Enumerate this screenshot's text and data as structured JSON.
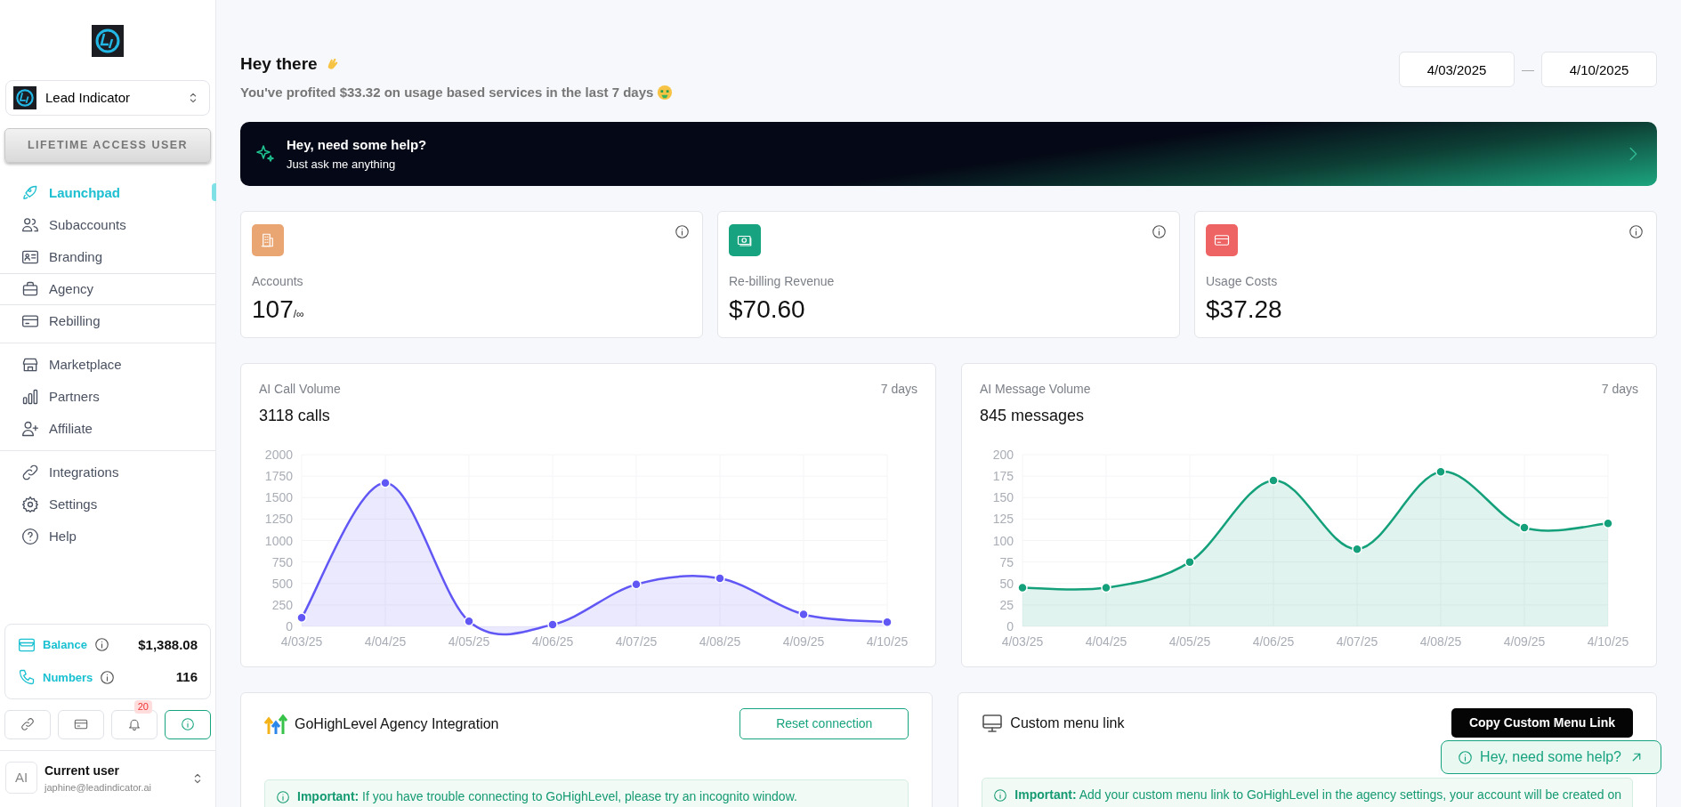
{
  "sidebar": {
    "workspace": "Lead Indicator",
    "access_badge": "LIFETIME ACCESS USER",
    "groups": [
      [
        {
          "label": "Launchpad",
          "selected": true,
          "hovered": false
        },
        {
          "label": "Subaccounts",
          "selected": false,
          "hovered": false
        },
        {
          "label": "Branding",
          "selected": false,
          "hovered": false
        },
        {
          "label": "Agency",
          "selected": false,
          "hovered": true
        },
        {
          "label": "Rebilling",
          "selected": false,
          "hovered": false
        }
      ],
      [
        {
          "label": "Marketplace",
          "selected": false,
          "hovered": false
        },
        {
          "label": "Partners",
          "selected": false,
          "hovered": false
        },
        {
          "label": "Affiliate",
          "selected": false,
          "hovered": false
        }
      ],
      [
        {
          "label": "Integrations",
          "selected": false,
          "hovered": false
        },
        {
          "label": "Settings",
          "selected": false,
          "hovered": false
        },
        {
          "label": "Help",
          "selected": false,
          "hovered": false
        }
      ]
    ],
    "balance": {
      "label": "Balance",
      "value": "$1,388.08"
    },
    "numbers": {
      "label": "Numbers",
      "value": "116"
    },
    "quick_buttons": [
      {
        "selected": false
      },
      {
        "selected": false
      },
      {
        "selected": false,
        "badge": "20"
      },
      {
        "selected": true
      }
    ],
    "user": {
      "avatar": "AI",
      "name": "Current user",
      "email": "japhine@leadindicator.ai"
    }
  },
  "header": {
    "greeting": "Hey there",
    "subtitle": "You've profited **$33.32** on usage based services in the last 7 days",
    "date_from": "4/03/2025",
    "date_separator": "—",
    "date_to": "4/10/2025"
  },
  "help_banner": {
    "title": "Hey, need some help?",
    "subtitle": "Just ask me anything"
  },
  "stats": [
    {
      "color": "#e9a673",
      "label": "Accounts",
      "value": "107",
      "suffix": "/∞"
    },
    {
      "color": "#17a37f",
      "label": "Re-billing Revenue",
      "value": "$70.60"
    },
    {
      "color": "#ee6363",
      "label": "Usage Costs",
      "value": "$37.28"
    }
  ],
  "charts": [
    {
      "title": "AI Call Volume",
      "period": "7 days",
      "total": "3118 calls",
      "chart_data": {
        "type": "area",
        "grid": true,
        "categories": [
          "4/03/25",
          "4/04/25",
          "4/05/25",
          "4/06/25",
          "4/07/25",
          "4/08/25",
          "4/09/25",
          "4/10/25"
        ],
        "series": [
          {
            "color": "#6157f5",
            "values": [
              100,
              1670,
              60,
              20,
              490,
              560,
              140,
              50
            ]
          }
        ],
        "ylim": [
          0,
          2000
        ],
        "yticks": [
          0,
          250,
          500,
          750,
          1000,
          1250,
          1500,
          1750,
          2000
        ]
      }
    },
    {
      "title": "AI Message Volume",
      "period": "7 days",
      "total": "845 messages",
      "chart_data": {
        "type": "area",
        "grid": true,
        "categories": [
          "4/03/25",
          "4/04/25",
          "4/05/25",
          "4/06/25",
          "4/07/25",
          "4/08/25",
          "4/09/25",
          "4/10/25"
        ],
        "series": [
          {
            "color": "#14a07a",
            "values": [
              45,
              45,
              75,
              170,
              90,
              180,
              115,
              120
            ]
          }
        ],
        "ylim": [
          0,
          200
        ],
        "yticks": [
          0,
          25,
          50,
          75,
          100,
          125,
          150,
          175,
          200
        ]
      }
    }
  ],
  "integrations": [
    {
      "title": "GoHighLevel Agency Integration",
      "button": "Reset connection",
      "note": "**Important:** If you have trouble connecting to GoHighLevel, please try an incognito window."
    },
    {
      "title": "Custom menu link",
      "button": "Copy Custom Menu Link",
      "note": "**Important:** Add your custom menu link to GoHighLevel in the agency settings, your account will be created on"
    }
  ],
  "help_button": {
    "label": "Hey, need some help?"
  }
}
